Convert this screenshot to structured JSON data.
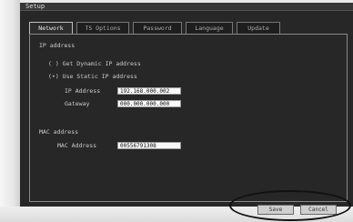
{
  "window": {
    "title": "Setup"
  },
  "tabs": [
    {
      "label": "Network"
    },
    {
      "label": "TS Options"
    },
    {
      "label": "Password"
    },
    {
      "label": "Language"
    },
    {
      "label": "Update"
    }
  ],
  "ip_section": {
    "heading": "IP address",
    "dynamic_option": "( ) Get Dynamic IP address",
    "static_option": "(•) Use Static IP address",
    "ip_label": "IP Address",
    "ip_value": "192.168.000.002",
    "gateway_label": "Gateway",
    "gateway_value": "000.000.000.000"
  },
  "mac_section": {
    "heading": "MAC address",
    "mac_label": "MAC Address",
    "mac_value": "00556791308"
  },
  "actions": {
    "save_label": "Save",
    "cancel_label": "Cancel"
  }
}
